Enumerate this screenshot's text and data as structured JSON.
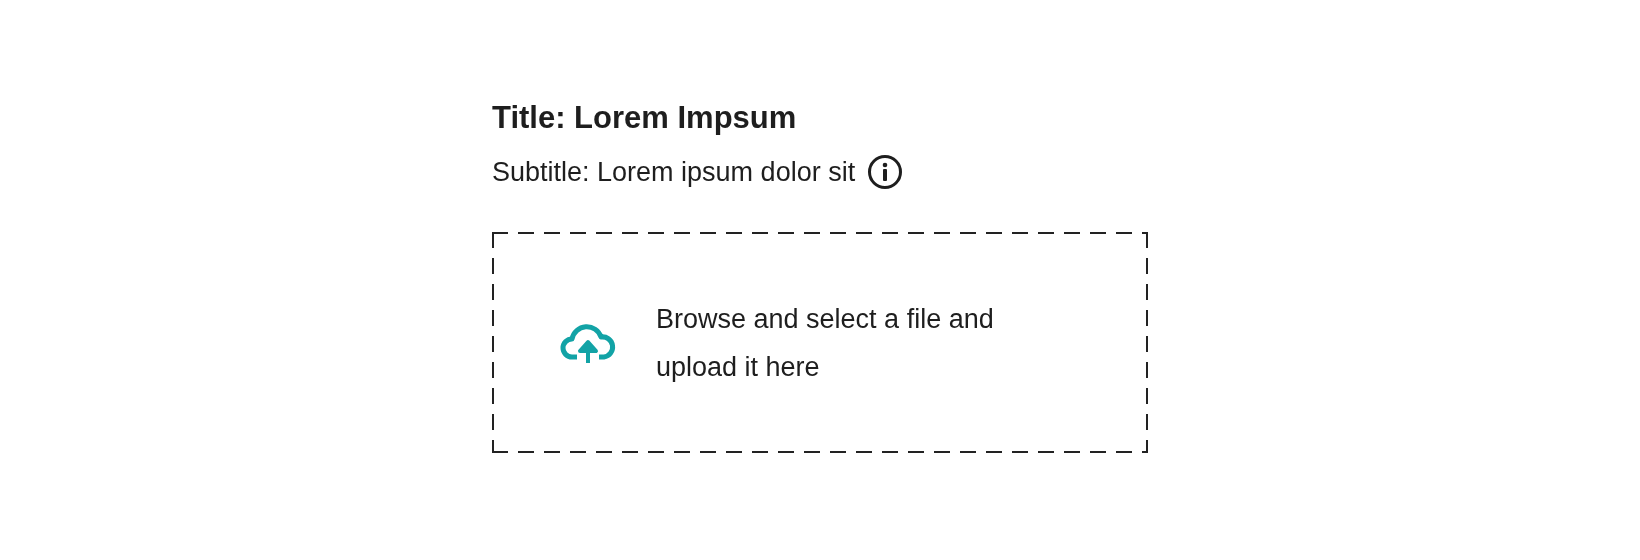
{
  "title": "Title: Lorem Impsum",
  "subtitle": "Subtitle: Lorem ipsum dolor sit",
  "dropzone": {
    "text": "Browse and select a file and upload it here"
  }
}
